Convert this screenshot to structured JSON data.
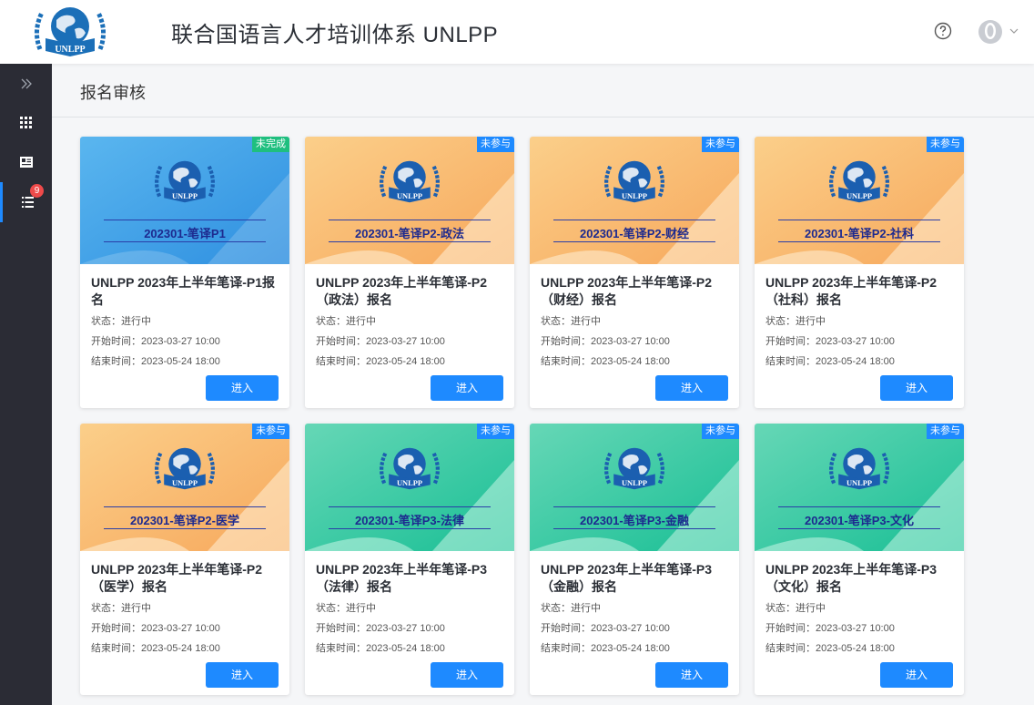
{
  "header": {
    "app_title": "联合国语言人才培训体系 UNLPP",
    "logo_text": "UNLPP",
    "help_icon": "question-circle-icon",
    "avatar_icon": "user-avatar-icon"
  },
  "sidebar": {
    "items": [
      {
        "name": "expand",
        "icon": "double-chevron-right-icon"
      },
      {
        "name": "apps",
        "icon": "grid-icon"
      },
      {
        "name": "profile",
        "icon": "id-card-icon"
      },
      {
        "name": "list",
        "icon": "list-icon",
        "badge": "9",
        "active": true
      }
    ]
  },
  "page": {
    "title": "报名审核"
  },
  "colors": {
    "accent": "#1e8aff",
    "sidebar": "#2b2c35",
    "tag_incomplete": "#1fbf7f",
    "tag_not_joined": "#1e8aff",
    "badge": "#ef4a4a"
  },
  "cards": [
    {
      "banner_text": "202301-笔译P1",
      "theme": "blue",
      "tag": "未完成",
      "tag_type": "incomplete",
      "title": "UNLPP 2023年上半年笔译-P1报名",
      "status": "状态：进行中",
      "start": "开始时间：2023-03-27 10:00",
      "end": "结束时间：2023-05-24 18:00",
      "button": "进入"
    },
    {
      "banner_text": "202301-笔译P2-政法",
      "theme": "orange",
      "tag": "未参与",
      "tag_type": "not_joined",
      "title": "UNLPP 2023年上半年笔译-P2（政法）报名",
      "status": "状态：进行中",
      "start": "开始时间：2023-03-27 10:00",
      "end": "结束时间：2023-05-24 18:00",
      "button": "进入"
    },
    {
      "banner_text": "202301-笔译P2-财经",
      "theme": "orange",
      "tag": "未参与",
      "tag_type": "not_joined",
      "title": "UNLPP 2023年上半年笔译-P2（财经）报名",
      "status": "状态：进行中",
      "start": "开始时间：2023-03-27 10:00",
      "end": "结束时间：2023-05-24 18:00",
      "button": "进入"
    },
    {
      "banner_text": "202301-笔译P2-社科",
      "theme": "orange",
      "tag": "未参与",
      "tag_type": "not_joined",
      "title": "UNLPP 2023年上半年笔译-P2（社科）报名",
      "status": "状态：进行中",
      "start": "开始时间：2023-03-27 10:00",
      "end": "结束时间：2023-05-24 18:00",
      "button": "进入"
    },
    {
      "banner_text": "202301-笔译P2-医学",
      "theme": "orange",
      "tag": "未参与",
      "tag_type": "not_joined",
      "title": "UNLPP 2023年上半年笔译-P2（医学）报名",
      "status": "状态：进行中",
      "start": "开始时间：2023-03-27 10:00",
      "end": "结束时间：2023-05-24 18:00",
      "button": "进入"
    },
    {
      "banner_text": "202301-笔译P3-法律",
      "theme": "green",
      "tag": "未参与",
      "tag_type": "not_joined",
      "title": "UNLPP 2023年上半年笔译-P3（法律）报名",
      "status": "状态：进行中",
      "start": "开始时间：2023-03-27 10:00",
      "end": "结束时间：2023-05-24 18:00",
      "button": "进入"
    },
    {
      "banner_text": "202301-笔译P3-金融",
      "theme": "green",
      "tag": "未参与",
      "tag_type": "not_joined",
      "title": "UNLPP 2023年上半年笔译-P3（金融）报名",
      "status": "状态：进行中",
      "start": "开始时间：2023-03-27 10:00",
      "end": "结束时间：2023-05-24 18:00",
      "button": "进入"
    },
    {
      "banner_text": "202301-笔译P3-文化",
      "theme": "green",
      "tag": "未参与",
      "tag_type": "not_joined",
      "title": "UNLPP 2023年上半年笔译-P3（文化）报名",
      "status": "状态：进行中",
      "start": "开始时间：2023-03-27 10:00",
      "end": "结束时间：2023-05-24 18:00",
      "button": "进入"
    }
  ]
}
